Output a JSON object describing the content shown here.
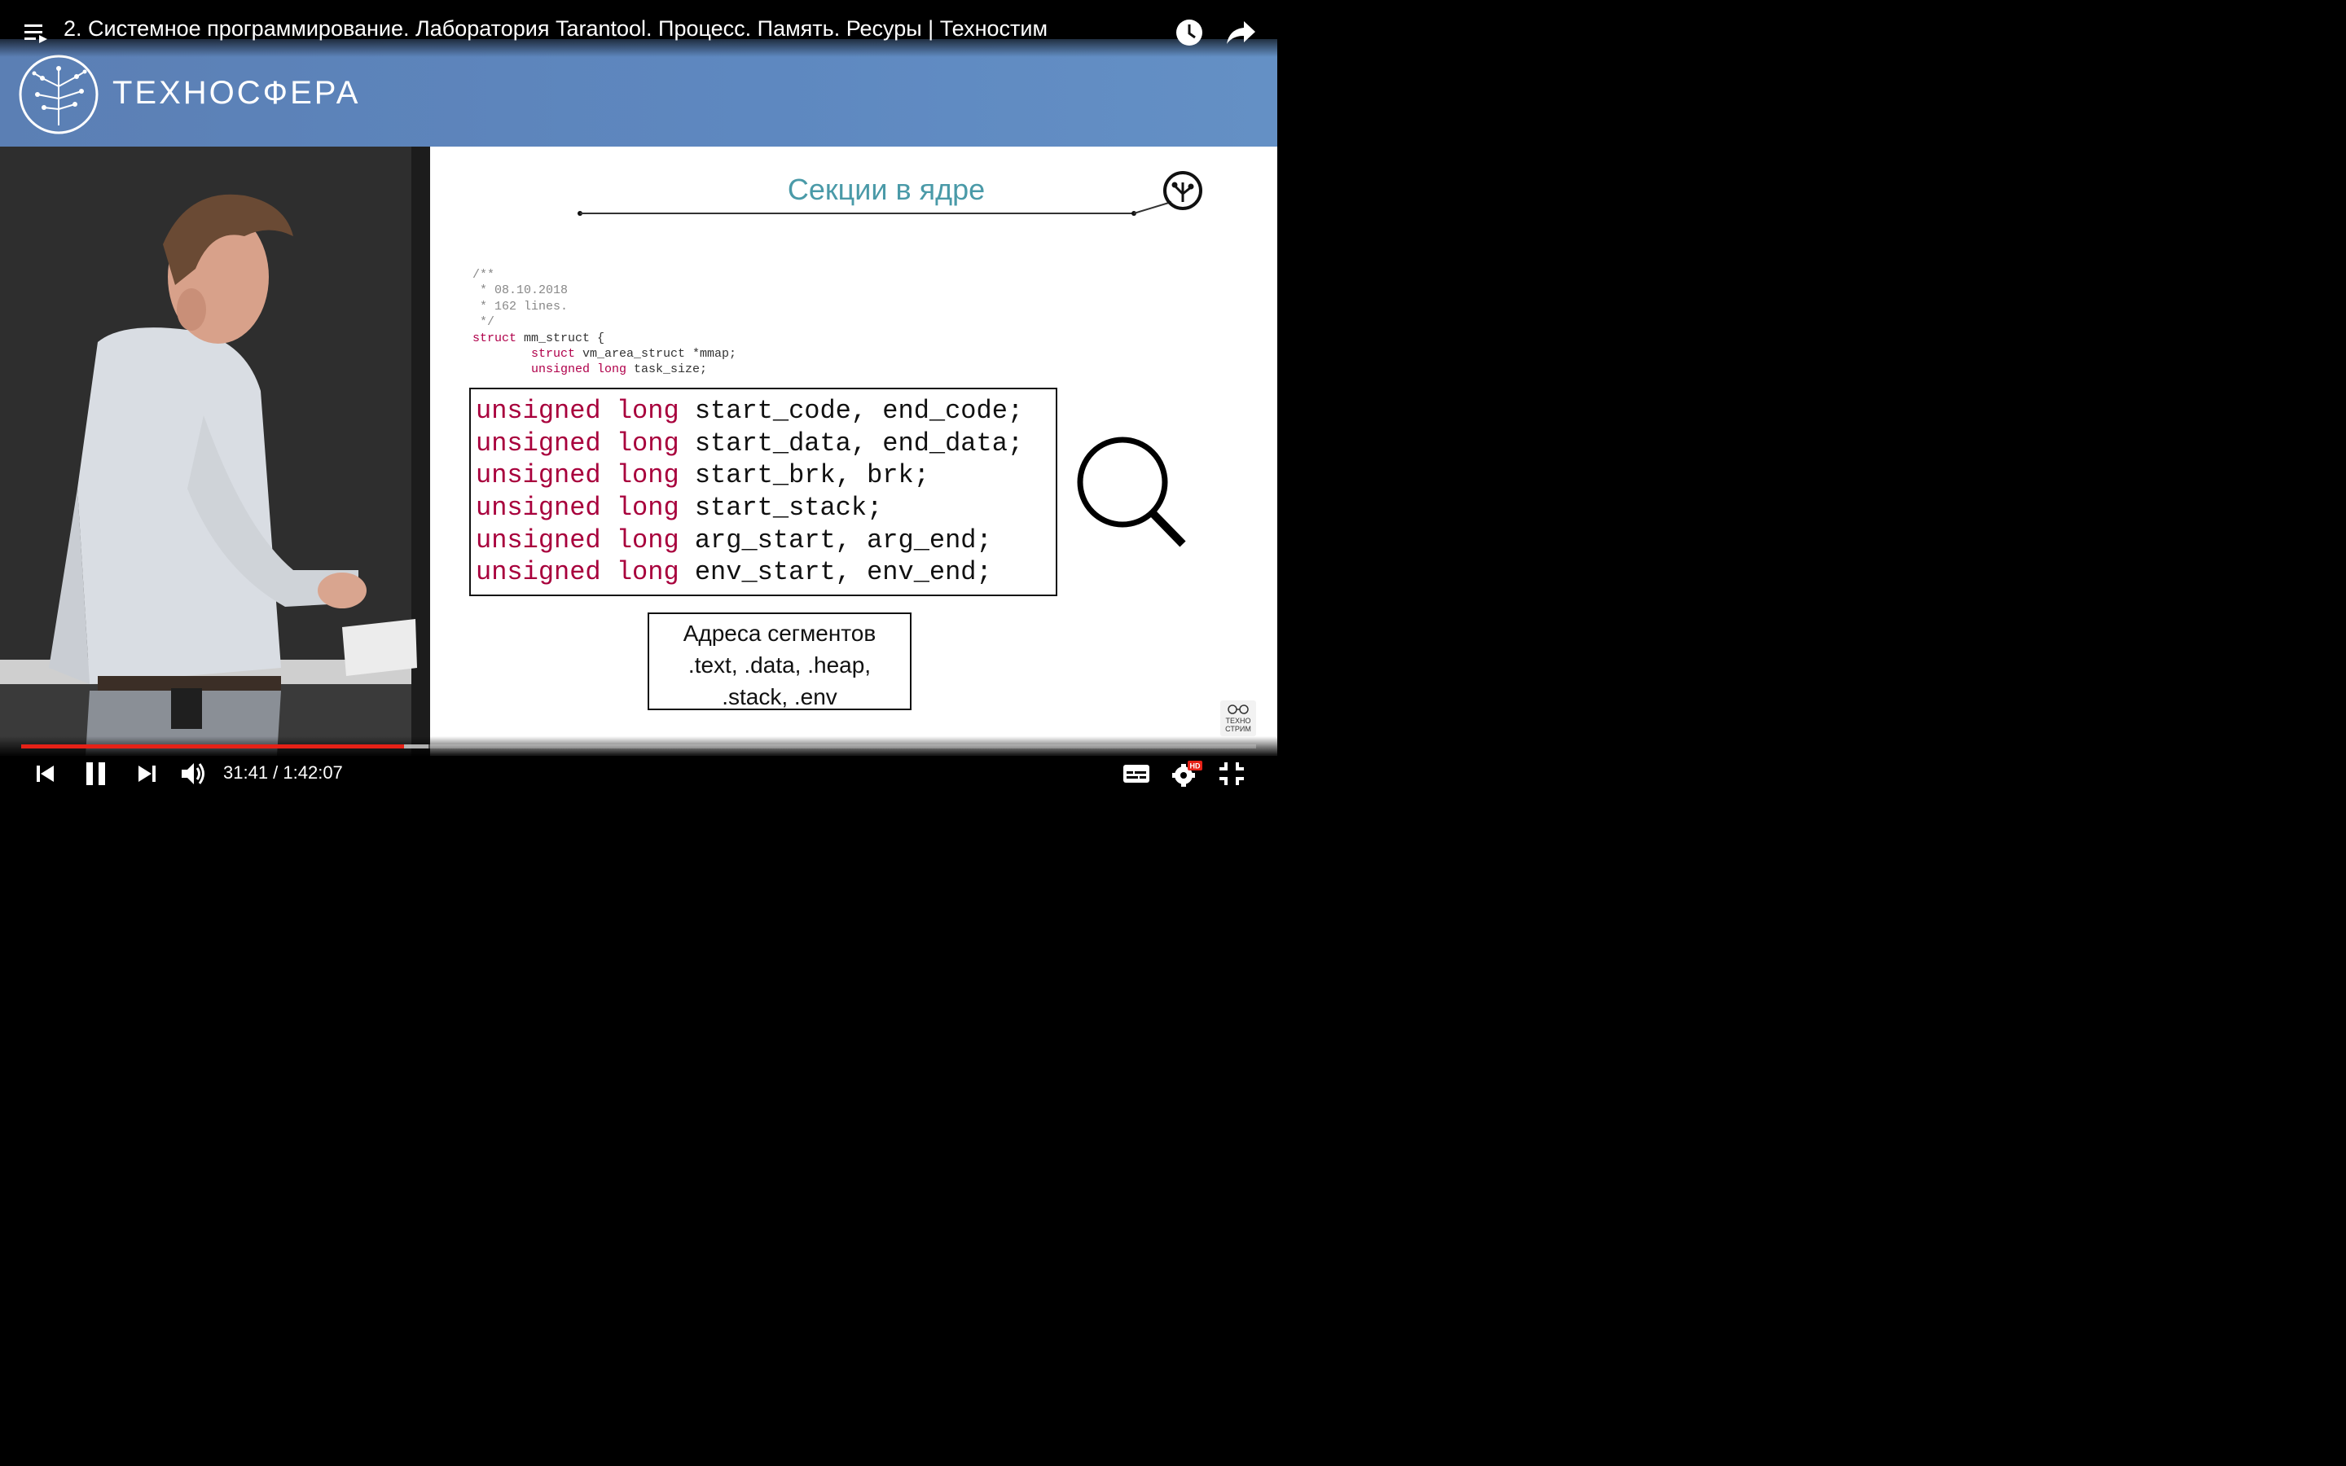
{
  "player": {
    "title": "2. Системное программирование. Лаборатория Tarantool. Процесс. Память. Ресуры | Техностим",
    "current_time": "31:41",
    "separator": " / ",
    "duration": "1:42:07",
    "time_text": "31:41 / 1:42:07",
    "progress_fraction": 0.3101,
    "buffered_fraction": 0.33,
    "quality_badge": "HD",
    "accent_color": "#e62117",
    "icons": [
      "playlist-icon",
      "watch-later-icon",
      "share-icon",
      "previous-icon",
      "pause-icon",
      "next-icon",
      "volume-icon",
      "subtitles-icon",
      "settings-icon",
      "exit-fullscreen-icon"
    ]
  },
  "header": {
    "brand": "ТЕХНОСФЕРА",
    "band_color": "#5e88c0"
  },
  "slide": {
    "title": "Секции в ядре",
    "code_comment": [
      "/**",
      " * 08.10.2018",
      " * 162 lines.",
      " */"
    ],
    "code_struct": {
      "line1_kw": "struct",
      "line1_rest": " mm_struct {",
      "line2_kw": "struct",
      "line2_rest": " vm_area_struct *mmap;",
      "line3_kw": "unsigned long",
      "line3_rest": " task_size;"
    },
    "fields": [
      {
        "type": "unsigned long",
        "names": "start_code, end_code;"
      },
      {
        "type": "unsigned long",
        "names": "start_data, end_data;"
      },
      {
        "type": "unsigned long",
        "names": "start_brk, brk;"
      },
      {
        "type": "unsigned long",
        "names": "start_stack;"
      },
      {
        "type": "unsigned long",
        "names": "arg_start, arg_end;"
      },
      {
        "type": "unsigned long",
        "names": "env_start, env_end;"
      }
    ],
    "segments_caption": [
      "Адреса сегментов",
      ".text, .data, .heap,",
      ".stack, .env"
    ]
  },
  "badge": {
    "line1": "ТЕХНО",
    "line2": "СТРИМ"
  }
}
